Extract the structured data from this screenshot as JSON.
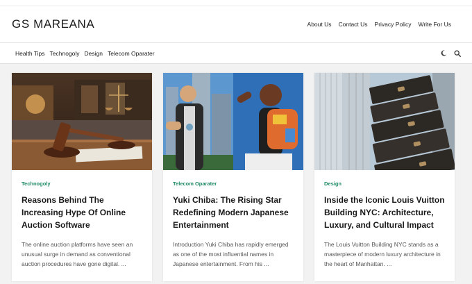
{
  "site": {
    "title": "GS MAREANA"
  },
  "topnav": [
    "About Us",
    "Contact Us",
    "Privacy Policy",
    "Write For Us"
  ],
  "catnav": [
    "Health Tips",
    "Technogoly",
    "Design",
    "Telecom Oparater"
  ],
  "icons": {
    "theme": "moon-icon",
    "search": "search-icon"
  },
  "colors": {
    "accent": "#1e8a66"
  },
  "cards": [
    {
      "category": "Technogoly",
      "title": "Reasons Behind The Increasing Hype Of Online Auction Software",
      "excerpt": "The online auction platforms have seen an unusual surge in demand as conventional auction procedures have gone digital. ..."
    },
    {
      "category": "Telecom Oparater",
      "title": "Yuki Chiba: The Rising Star Redefining Modern Japanese Entertainment",
      "excerpt": "Introduction Yuki Chiba has rapidly emerged as one of the most influential names in Japanese entertainment. From his ..."
    },
    {
      "category": "Design",
      "title": "Inside the Iconic Louis Vuitton Building NYC: Architecture, Luxury, and Cultural Impact",
      "excerpt": "The Louis Vuitton Building NYC stands as a masterpiece of modern luxury architecture in the heart of Manhattan. ..."
    }
  ]
}
